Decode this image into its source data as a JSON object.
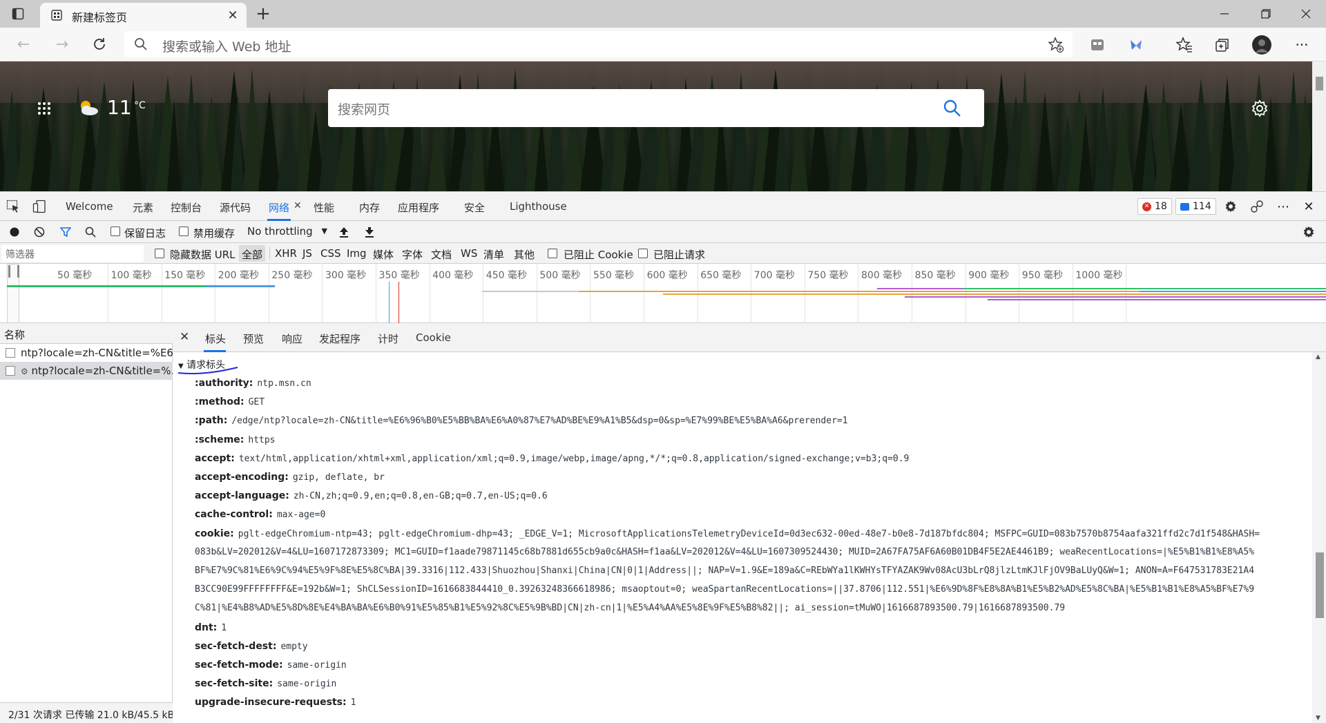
{
  "browser": {
    "tab_title": "新建标签页",
    "address_placeholder": "搜索或输入 Web 地址"
  },
  "page": {
    "weather_temp": "11",
    "weather_unit": "°C",
    "search_placeholder": "搜索网页"
  },
  "devtools": {
    "tabs": [
      "Welcome",
      "元素",
      "控制台",
      "源代码",
      "网络",
      "性能",
      "内存",
      "应用程序",
      "安全",
      "Lighthouse"
    ],
    "active_tab": "网络",
    "error_count": "18",
    "message_count": "114",
    "network": {
      "preserve_log": "保留日志",
      "disable_cache": "禁用缓存",
      "throttling": "No throttling",
      "filter_placeholder": "筛选器",
      "hide_data_url": "隐藏数据 URL",
      "filter_types": [
        "全部",
        "XHR",
        "JS",
        "CSS",
        "Img",
        "媒体",
        "字体",
        "文档",
        "WS",
        "清单",
        "其他"
      ],
      "blocked_cookies": "已阻止 Cookie",
      "blocked_requests": "已阻止请求",
      "timeline_ticks": [
        "50 毫秒",
        "100 毫秒",
        "150 毫秒",
        "200 毫秒",
        "250 毫秒",
        "300 毫秒",
        "350 毫秒",
        "400 毫秒",
        "450 毫秒",
        "500 毫秒",
        "550 毫秒",
        "600 毫秒",
        "650 毫秒",
        "700 毫秒",
        "750 毫秒",
        "800 毫秒",
        "850 毫秒",
        "900 毫秒",
        "950 毫秒",
        "1000 毫秒"
      ],
      "name_header": "名称",
      "requests": [
        "ntp?locale=zh-CN&title=%E6...",
        "ntp?locale=zh-CN&title=%..."
      ],
      "footer": "2/31 次请求  已传输 21.0 kB/45.5 kB"
    },
    "details": {
      "tabs": [
        "标头",
        "预览",
        "响应",
        "发起程序",
        "计时",
        "Cookie"
      ],
      "section_title": "请求标头",
      "headers": [
        {
          "name": ":authority:",
          "value": "ntp.msn.cn"
        },
        {
          "name": ":method:",
          "value": "GET"
        },
        {
          "name": ":path:",
          "value": "/edge/ntp?locale=zh-CN&title=%E6%96%B0%E5%BB%BA%E6%A0%87%E7%AD%BE%E9%A1%B5&dsp=0&sp=%E7%99%BE%E5%BA%A6&prerender=1"
        },
        {
          "name": ":scheme:",
          "value": "https"
        },
        {
          "name": "accept:",
          "value": "text/html,application/xhtml+xml,application/xml;q=0.9,image/webp,image/apng,*/*;q=0.8,application/signed-exchange;v=b3;q=0.9"
        },
        {
          "name": "accept-encoding:",
          "value": "gzip, deflate, br"
        },
        {
          "name": "accept-language:",
          "value": "zh-CN,zh;q=0.9,en;q=0.8,en-GB;q=0.7,en-US;q=0.6"
        },
        {
          "name": "cache-control:",
          "value": "max-age=0"
        },
        {
          "name": "cookie:",
          "value": "pglt-edgeChromium-ntp=43; pglt-edgeChromium-dhp=43; _EDGE_V=1; MicrosoftApplicationsTelemetryDeviceId=0d3ec632-00ed-48e7-b0e8-7d187bfdc804; MSFPC=GUID=083b7570b8754aafa321ffd2c7d1f548&HASH="
        }
      ],
      "cookie_continuation": [
        "083b&LV=202012&V=4&LU=1607172873309; MC1=GUID=f1aade79871145c68b7881d655cb9a0c&HASH=f1aa&LV=202012&V=4&LU=1607309524430; MUID=2A67FA75AF6A60B01DB4F5E2AE4461B9; weaRecentLocations=|%E5%B1%B1%E8%A5%",
        "BF%E7%9C%81%E6%9C%94%E5%9F%8E%E5%8C%BA|39.3316|112.433|Shuozhou|Shanxi|China|CN|0|1|Address||; NAP=V=1.9&E=189a&C=REbWYa1lKWHYsTFYAZAK9Wv08AcU3bLrQ8jlzLtmKJlFjOV9BaLUyQ&W=1; ANON=A=F647531783E21A4",
        "B3CC90E99FFFFFFFF&E=192b&W=1; ShCLSessionID=1616683844410_0.39263248366618986; msaoptout=0; weaSpartanRecentLocations=||37.8706|112.551|%E6%9D%8F%E8%8A%B1%E5%B2%AD%E5%8C%BA|%E5%B1%B1%E8%A5%BF%E7%9",
        "C%81|%E4%B8%AD%E5%8D%8E%E4%BA%BA%E6%B0%91%E5%85%B1%E5%92%8C%E5%9B%BD|CN|zh-cn|1|%E5%A4%AA%E5%8E%9F%E5%B8%82||; ai_session=tMuWO|1616687893500.79|1616687893500.79"
      ],
      "headers_after": [
        {
          "name": "dnt:",
          "value": "1"
        },
        {
          "name": "sec-fetch-dest:",
          "value": "empty"
        },
        {
          "name": "sec-fetch-mode:",
          "value": "same-origin"
        },
        {
          "name": "sec-fetch-site:",
          "value": "same-origin"
        },
        {
          "name": "upgrade-insecure-requests:",
          "value": "1"
        }
      ]
    }
  },
  "colors": {
    "accent": "#1a73e8",
    "error": "#d93025",
    "waterfall_green": "#2dbf6c",
    "waterfall_blue": "#4e9be0",
    "waterfall_orange": "#e8a23a",
    "waterfall_purple": "#b05bd6"
  }
}
